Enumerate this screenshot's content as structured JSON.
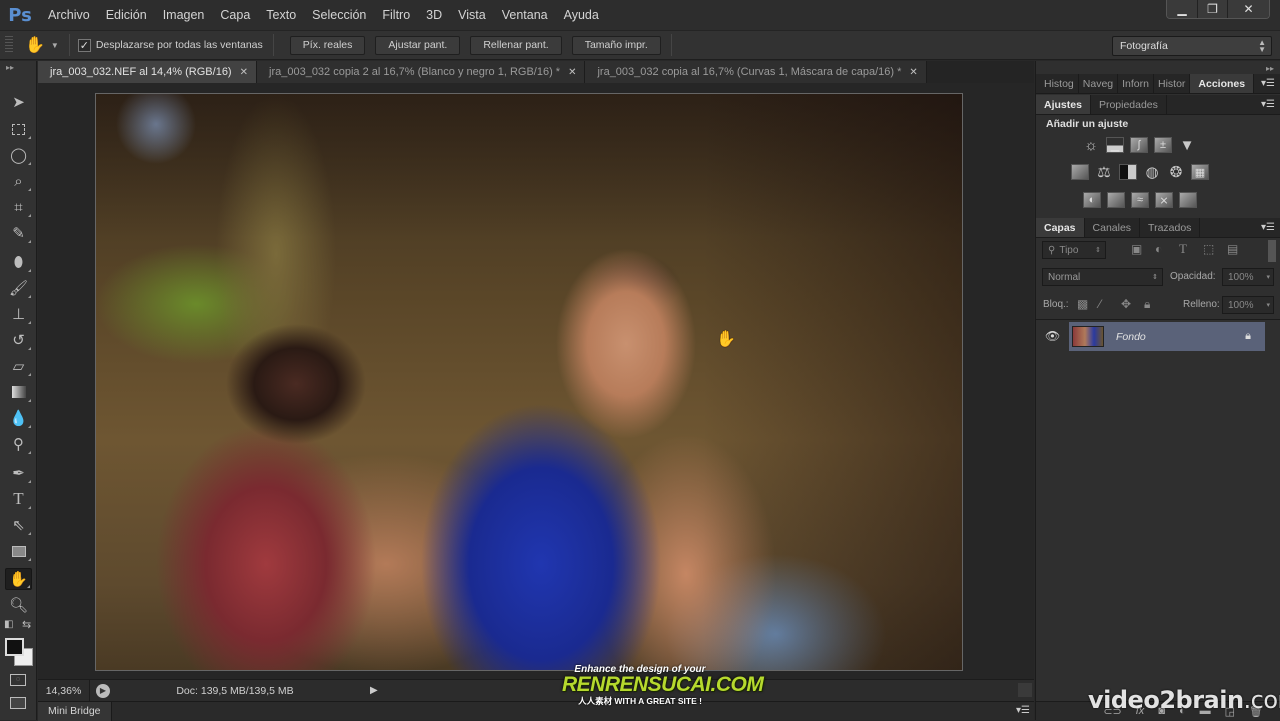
{
  "app": {
    "logo": "Ps"
  },
  "menu": [
    "Archivo",
    "Edición",
    "Imagen",
    "Capa",
    "Texto",
    "Selección",
    "Filtro",
    "3D",
    "Vista",
    "Ventana",
    "Ayuda"
  ],
  "window_controls": {
    "minimize": "▁",
    "restore": "❐",
    "close": "✕"
  },
  "options_bar": {
    "tool_icon": "hand-icon",
    "checkbox_label": "Desplazarse por todas las ventanas",
    "checkbox_checked": true,
    "buttons": [
      "Píx. reales",
      "Ajustar pant.",
      "Rellenar pant.",
      "Tamaño impr."
    ],
    "workspace": "Fotografía"
  },
  "doc_tabs": [
    {
      "title": "jra_003_032.NEF al 14,4% (RGB/16)",
      "active": true
    },
    {
      "title": "jra_003_032 copia 2 al 16,7% (Blanco y negro 1, RGB/16) *",
      "active": false
    },
    {
      "title": "jra_003_032 copia al 16,7% (Curvas 1, Máscara de capa/16) *",
      "active": false
    }
  ],
  "status": {
    "zoom": "14,36%",
    "doc": "Doc: 139,5 MB/139,5 MB"
  },
  "bottom": {
    "mini_bridge": "Mini Bridge"
  },
  "panels": {
    "top_tabs": [
      "Histog",
      "Naveg",
      "Inforn",
      "Histor",
      "Acciones"
    ],
    "top_active": "Acciones",
    "adj_tabs": [
      "Ajustes",
      "Propiedades"
    ],
    "adj_title": "Añadir un ajuste",
    "layer_tabs": [
      "Capas",
      "Canales",
      "Trazados"
    ],
    "filter": "Tipo",
    "blend_mode": "Normal",
    "opacity_label": "Opacidad:",
    "opacity": "100%",
    "lock_label": "Bloq.:",
    "fill_label": "Relleno:",
    "fill": "100%",
    "layers": [
      {
        "name": "Fondo",
        "visible": true,
        "locked": true
      }
    ]
  },
  "watermarks": {
    "v2b_a": "video2brain",
    "v2b_b": ".com",
    "rr1": "Enhance the design of your",
    "rr2": "RENRENSUCAI.COM",
    "rr3": "人人素材  WITH A GREAT SITE !"
  }
}
